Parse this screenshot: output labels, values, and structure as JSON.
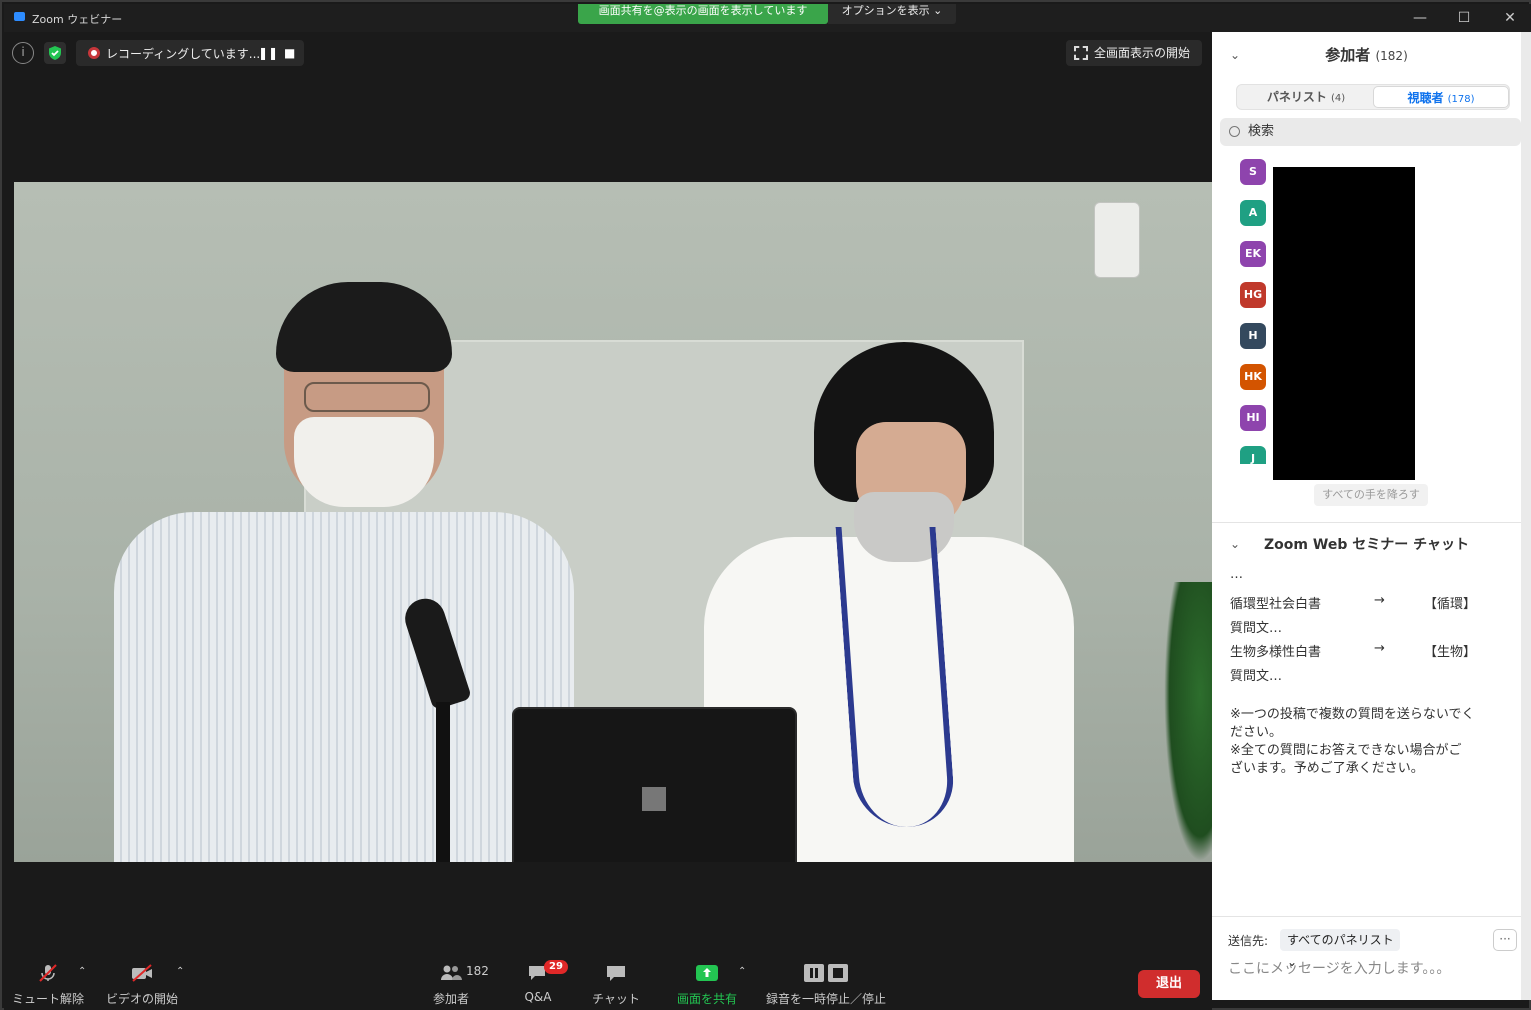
{
  "window": {
    "title": "Zoom ウェビナー",
    "share_banner": "画面共有を@表示の画面を表示しています",
    "view_options": "オプションを表示 ⌄",
    "min": "—",
    "max": "☐",
    "close": "✕"
  },
  "video": {
    "recording_text": "レコーディングしています...",
    "pause": "❚❚",
    "stop": "■",
    "fullscreen_label": "全画面表示の開始",
    "info": "i"
  },
  "toolbar": {
    "unmute": "ミュート解除",
    "start_video": "ビデオの開始",
    "participants": "参加者",
    "participants_count": "182",
    "qa": "Q&A",
    "qa_badge": "29",
    "chat": "チャット",
    "share_screen": "画面を共有",
    "pause_stop_recording": "録音を一時停止／停止",
    "leave": "退出",
    "caret": "⌃"
  },
  "participants_panel": {
    "title": "参加者",
    "count": "(182)",
    "tab_panelists": "パネリスト",
    "tab_panelists_count": "(4)",
    "tab_attendees": "視聴者",
    "tab_attendees_count": "(178)",
    "search_placeholder": "検索",
    "avatars": [
      {
        "initials": "S",
        "color": "#8e44ad"
      },
      {
        "initials": "A",
        "color": "#1fa083"
      },
      {
        "initials": "EK",
        "color": "#8e44ad"
      },
      {
        "initials": "HG",
        "color": "#c0392b"
      },
      {
        "initials": "H",
        "color": "#34495e"
      },
      {
        "initials": "HK",
        "color": "#d35400"
      },
      {
        "initials": "HI",
        "color": "#8e44ad"
      },
      {
        "initials": "J",
        "color": "#1fa083"
      }
    ],
    "lower_all_hands": "すべての手を降ろす"
  },
  "chat_panel": {
    "title": "Zoom Web セミナー チャット",
    "line0": "…",
    "row1_left": "循環型社会白書",
    "row1_arrow": "→",
    "row1_right": "【循環】",
    "row1_sub": "質問文…",
    "row2_left": "生物多様性白書",
    "row2_arrow": "→",
    "row2_right": "【生物】",
    "row2_sub": "質問文…",
    "note1a": "※一つの投稿で複数の質問を送らないでく",
    "note1b": "ださい。",
    "note2a": "※全ての質問にお答えできない場合がご",
    "note2b": "ざいます。予めご了承ください。",
    "send_to_label": "送信先:",
    "send_to_value": "すべてのパネリスト ⌄",
    "more": "···",
    "input_placeholder": "ここにメッセージを入力します。。。"
  }
}
